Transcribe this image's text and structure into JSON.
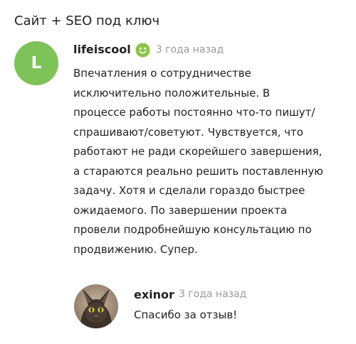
{
  "page": {
    "title": "Сайт + SEO под ключ"
  },
  "review": {
    "avatar_letter": "L",
    "avatar_color": "#7dc35a",
    "author": "lifeiscool",
    "reaction_icon": "smile-icon",
    "reaction_color": "#8bc34a",
    "time": "3 года назад",
    "text": "Впечатления о сотрудничестве\nисключительно положительные. В\nпроцессе работы  постоянно что-то пишут/\nспрашивают/советуют. Чувствуется, что\nработают не ради скорейшего завершения,\nа стараются реально решить поставленную\nзадачу. Хотя и сделали гораздо быстрее\nожидаемого. По завершении проекта\nпровели подробнейшую консультацию по\nпродвижению. Супер."
  },
  "reply": {
    "author": "exinor",
    "time": "3 года назад",
    "text": "Спасибо за отзыв!"
  }
}
